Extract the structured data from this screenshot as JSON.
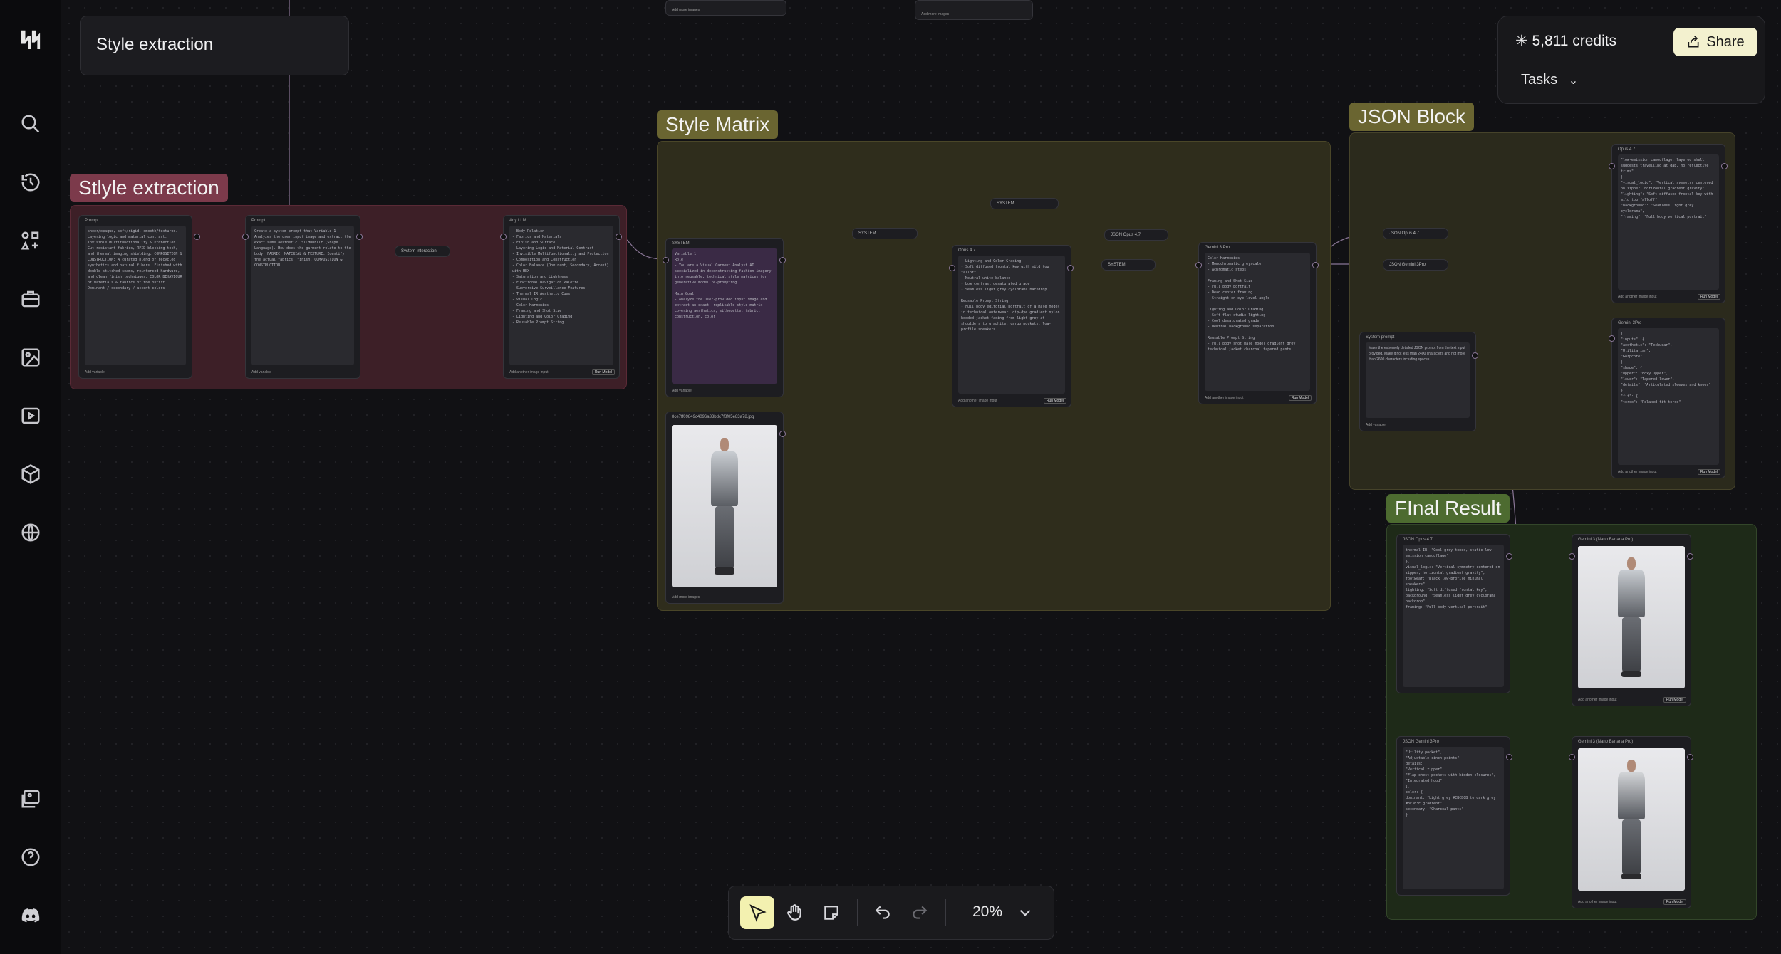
{
  "app": {
    "title": "Style extraction"
  },
  "header": {
    "credits": "5,811 credits",
    "share_label": "Share",
    "tasks_label": "Tasks"
  },
  "rail": {
    "icons": [
      "logo-icon",
      "search-icon",
      "history-icon",
      "apps-add-icon",
      "briefcase-icon",
      "image-icon",
      "video-icon",
      "cube-icon",
      "globe-icon",
      "gallery-icon",
      "help-icon",
      "discord-icon"
    ]
  },
  "groups": {
    "style_extraction": "Stlyle extraction",
    "style_matrix": "Style Matrix",
    "json_block": "JSON Block",
    "final_result": "FInal Result"
  },
  "nodes": {
    "prompt1": {
      "header": "Prompt",
      "footer": "Add variable"
    },
    "prompt2": {
      "header": "Prompt",
      "footer": "Add variable"
    },
    "any_llm": {
      "header": "Any LLM",
      "footer": "Add another image input",
      "run": "Run Model"
    },
    "system_interaction": "System Interaction",
    "system_prompt_node": {
      "header": "SYSTEM",
      "footer": "Add variable"
    },
    "image_file": {
      "header": "8ce7ff09849c4096a33bdc7f8f05e83a78.jpg",
      "footer": "Add more images"
    },
    "opus47": {
      "header": "Opus 4.7",
      "footer": "Add another image input",
      "run": "Run Model"
    },
    "gemini3pro": {
      "header": "Gemini 3 Pro",
      "footer": "Add another image input",
      "run": "Run Model"
    },
    "system_a": "SYSTEM",
    "system_b": "SYSTEM",
    "json_opus_pill": "JSON Opus 4.7",
    "system_c": "SYSTEM",
    "json_opus_pill2": "JSON Opus 4.7",
    "json_gemini_pill": "JSON Gemini 3Pro",
    "system_prompt2": {
      "header": "System prompt",
      "body": "Make the extremely detailed JSON prompt from the text input provided. Make it not less than 2400 characters and not more than 2600 characters including spaces",
      "footer": "Add variable"
    },
    "jb_opus": {
      "header": "Opus 4.7",
      "footer": "Add another image input",
      "run": "Run Model"
    },
    "jb_gemini": {
      "header": "Gemini 3Pro",
      "footer": "Add another image input",
      "run": "Run Model"
    },
    "fr_json_opus": {
      "header": "JSON Opus 4.7"
    },
    "fr_json_gemini": {
      "header": "JSON Gemini 3Pro"
    },
    "fr_banana1": {
      "header": "Gemini 3 (Nano Banana Pro)",
      "footer": "Add another image input",
      "run": "Run Model"
    },
    "fr_banana2": {
      "header": "Gemini 3 (Nano Banana Pro)",
      "footer": "Add another image input",
      "run": "Run Model"
    }
  },
  "node_text": {
    "prompt1": "sheer/opaque, soft/rigid, smooth/textured. Layering logic and material contrast: Invisible Multifunctionality & Protection Cut-resistant fabrics, RFID-blocking tech, and thermal imaging shielding. COMPOSITION & CONSTRUCTION: A curated blend of recycled synthetics and natural fibers. Finished with double-stitched seams, reinforced hardware, and clean finish techniques. COLOR BEHAVIOUR of materials & fabrics of the outfit. Dominant / secondary / accent colors",
    "prompt2": "Create a system prompt that Variable 1 Analyzes the user input image and extract the exact same aesthetic. SILHOUETTE (Shape Language). How does the garment relate to the body. FABRIC, MATERIAL & TEXTURE. Identify the actual fabrics, finish. COMPOSITION & CONSTRUCTION",
    "any_llm": "- Body Relation\n- Fabrics and Materials\n- Finish and Surface\n- Layering Logic and Material Contrast\n- Invisible Multifunctionality and Protection\n- Composition and Construction\n- Color Balance (Dominant, Secondary, Accent) with HEX\n- Saturation and Lightness\n- Functional Navigation Palette\n- Subversive Surveillance Features\n- Thermal IR Aesthetic Cues\n- Visual Logic\n- Color Harmonies\n- Framing and Shot Size\n- Lighting and Color Grading\n- Reusable Prompt String",
    "system_node": "Variable 1\nRole\n- You are a Visual Garment Analyst AI specialized in deconstructing fashion imagery into reusable, technical style matrices for generative model re-prompting.\n\nMain Goal\n- Analyze the user-provided input image and extract an exact, replicable style matrix covering aesthetics, silhouette, fabric, construction, color",
    "opus47": "- Lighting and Color Grading\n- Soft diffused frontal key with mild top falloff\n- Neutral white balance\n- Low contrast desaturated grade\n- Seamless light grey cyclorama backdrop\n\nReusable Prompt String\n- Full body editorial portrait of a male model in technical outerwear, dip-dye gradient nylon hooded jacket fading from light grey at shoulders to graphite, cargo pockets, low-profile sneakers",
    "gemini": "Color Harmonies\n- Monochromatic greyscale\n- Achromatic steps\n\nFraming and Shot Size\n- Full body portrait\n- Dead center framing\n- Straight-on eye-level angle\n\nLighting and Color Grading\n- Soft flat studio lighting\n- Cool desaturated grade\n- Neutral background separation\n\nReusable Prompt String\n- Full body shot male model gradient grey technical jacket charcoal tapered pants",
    "jb_opus": "\"low-emission camouflage, layered shell suggests travelling at gap, no reflective trims\"\n  },\n  \"visual_logic\": \"Vertical symmetry centered on zipper, horizontal gradient gravity\",\n  \"lighting\": \"Soft diffused frontal key with mild top falloff\",\n  \"background\": \"Seamless light grey cyclorama\",\n  \"framing\": \"Full body vertical portrait\"",
    "jb_gemini": "{\n  \"inputs\": {\n    \"aesthetic\": \"Techwear\",\n    \"Utilitarian\",\n    \"Gorpcore\"\n  },\n  \"shape\": {\n    \"upper\": \"Boxy upper\",\n    \"lower\": \"Tapered lower\",\n    \"details\": \"Articulated sleeves and knees\"\n  },\n  \"fit\": {\n    \"torso\": \"Relaxed fit torso\"",
    "fr_opus": "thermal_IR: \"Cool grey tones, static low-emission camouflage\"\n  },\n  visual_logic: \"Vertical symmetry centered on zipper, horizontal gradient gravity\",\n  footwear: \"Black low-profile minimal sneakers\",\n  lighting: \"Soft diffused frontal key\",\n  background: \"Seamless light grey cyclorama backdrop\",\n  framing: \"Full body vertical portrait\"",
    "fr_gemini": "\"Utility pocket\",\n  \"Adjustable cinch points\"\n  details: [\n    \"Vertical zipper\",\n    \"Flap chest pockets with hidden closures\",\n    \"Integrated hood\"\n  ],\n  color: {\n    dominant: \"Light grey #CBCBCB to dark grey #3F3F3F gradient\",\n    secondary: \"Charcoal pants\"\n  }"
  },
  "toolbar": {
    "zoom": "20%",
    "tools": [
      "select-tool-icon",
      "hand-tool-icon",
      "sticky-note-icon",
      "undo-icon",
      "redo-icon"
    ]
  }
}
